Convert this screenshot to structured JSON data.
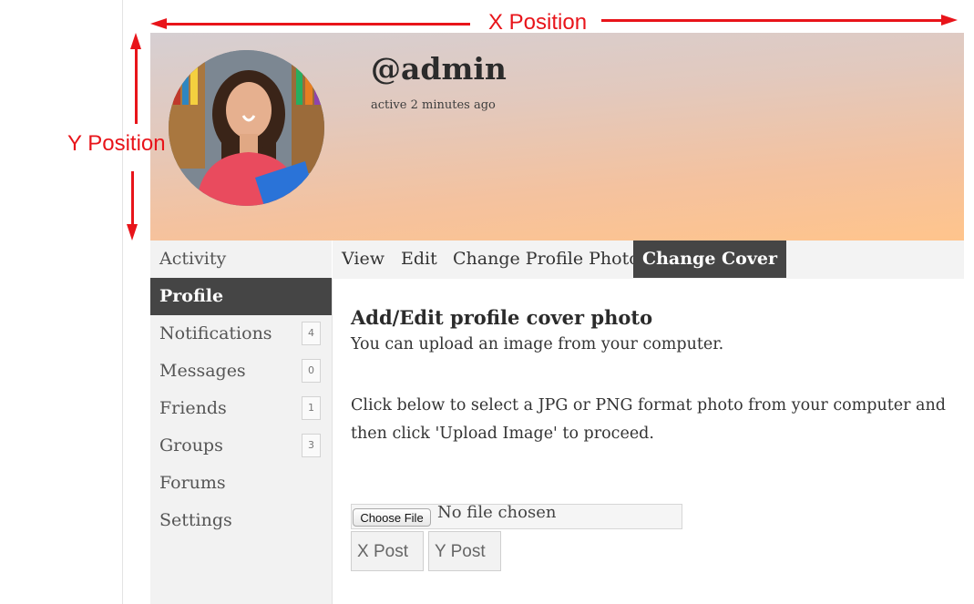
{
  "annotations": {
    "x_label": "X Position",
    "y_label": "Y Position",
    "color": "#e8141a"
  },
  "profile": {
    "username": "@admin",
    "activity": "active 2 minutes ago"
  },
  "nav": {
    "items": [
      {
        "label": "Activity",
        "count": null,
        "active": false
      },
      {
        "label": "Profile",
        "count": null,
        "active": true
      },
      {
        "label": "Notifications",
        "count": "4",
        "active": false
      },
      {
        "label": "Messages",
        "count": "0",
        "active": false
      },
      {
        "label": "Friends",
        "count": "1",
        "active": false
      },
      {
        "label": "Groups",
        "count": "3",
        "active": false
      },
      {
        "label": "Forums",
        "count": null,
        "active": false
      },
      {
        "label": "Settings",
        "count": null,
        "active": false
      }
    ]
  },
  "subnav": {
    "tabs": [
      {
        "label": "View",
        "active": false
      },
      {
        "label": "Edit",
        "active": false
      },
      {
        "label": "Change Profile Photo",
        "active": false
      },
      {
        "label": "Change Cover",
        "active": true
      }
    ]
  },
  "main": {
    "title": "Add/Edit profile cover photo",
    "intro": "You can upload an image from your computer.",
    "instructions": "Click below to select a JPG or PNG format photo from your computer and then click 'Upload Image' to proceed.",
    "file_button": "Choose File",
    "file_status": "No file chosen",
    "x_post": "X Post",
    "y_post": "Y Post"
  }
}
